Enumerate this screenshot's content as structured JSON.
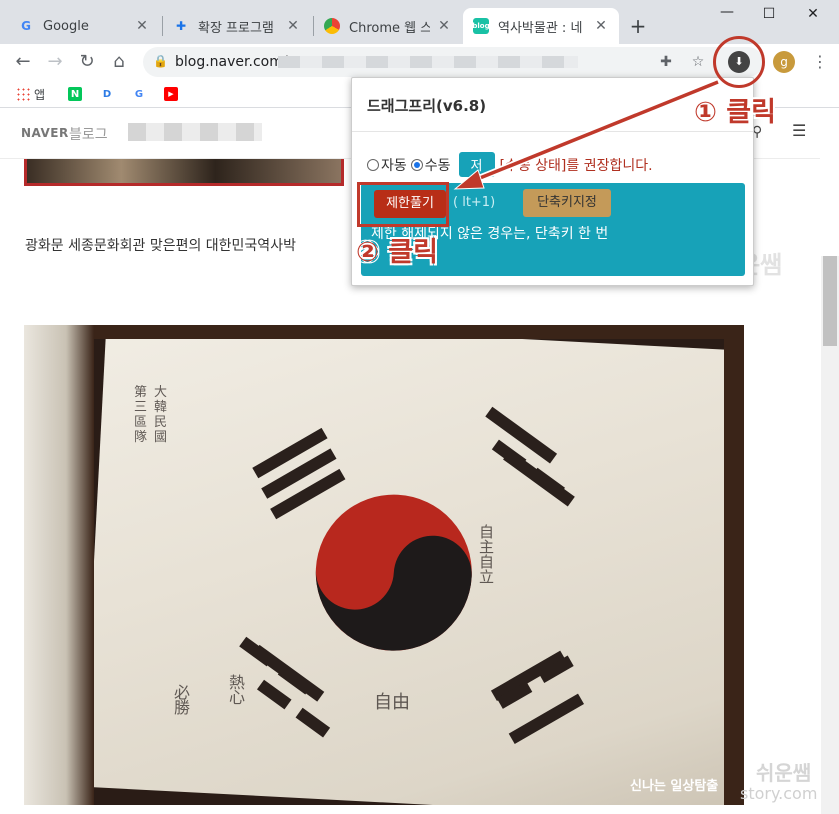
{
  "browser": {
    "tabs": [
      {
        "title": "Google",
        "icon": "google-icon",
        "active": false
      },
      {
        "title": "확장 프로그램",
        "icon": "puzzle-icon",
        "active": false
      },
      {
        "title": "Chrome 웹 스토어",
        "icon": "chrome-webstore-icon",
        "active": false
      },
      {
        "title": "역사박물관 : 네",
        "icon": "blog-icon",
        "active": true
      }
    ],
    "url": "blog.naver.com/",
    "bookmarks": [
      {
        "label": "앱",
        "icon": "apps-grid-icon"
      },
      {
        "label": "",
        "icon": "naver-icon"
      },
      {
        "label": "",
        "icon": "daum-icon"
      },
      {
        "label": "",
        "icon": "google-icon"
      },
      {
        "label": "",
        "icon": "youtube-icon"
      }
    ],
    "profile_initial": "g"
  },
  "page": {
    "logo": "NAVER",
    "blog_label": "블로그",
    "paragraph": "광화문 세종문화회관 맞은편의 대한민국역사박",
    "watermark": "쉬운쌤",
    "footer_watermark_1": "쉬운쌤",
    "footer_watermark_2": "story.com",
    "photo_caption": "신나는 일상탐출",
    "flag_writing": [
      "大韓民國",
      "第三區隊",
      "自由",
      "必勝",
      "熱心",
      "自主自立"
    ]
  },
  "popup": {
    "title": "드래그프리(v6.8)",
    "radio_auto": "자동",
    "radio_manual": "수동",
    "apply_label": "저",
    "recommend_text": "[수동 상태]를 권장합니다.",
    "unlock_label": "제한풀기",
    "shortcut_hint": "(  lt+1)",
    "shortcut_label": "단축키지정",
    "panel_text": "제한 해제되지 않은 경우는, 단축키 한 번"
  },
  "annotations": {
    "step1": "① 클릭",
    "step2": "② 클릭"
  },
  "colors": {
    "annotation_red": "#c0392b",
    "popup_teal": "#17a2b8",
    "unlock_red": "#b82e17",
    "shortcut_tan": "#c49a59"
  }
}
